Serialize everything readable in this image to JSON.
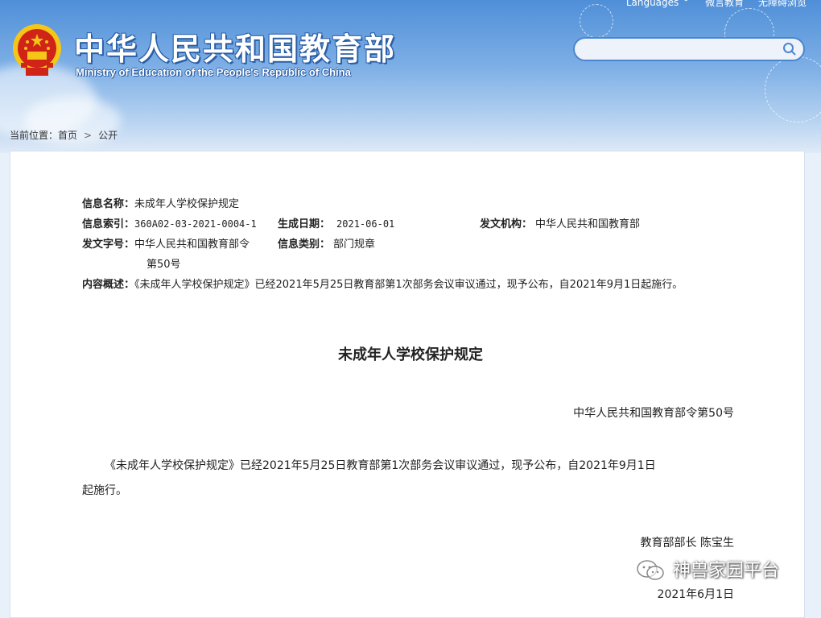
{
  "header": {
    "site_title": "中华人民共和国教育部",
    "site_subtitle": "Ministry of Education of the People's Republic of China",
    "links": [
      "Languages",
      "微言教育",
      "无障碍浏览"
    ],
    "search_placeholder": ""
  },
  "breadcrumb": {
    "prefix": "当前位置：",
    "items": [
      "首页",
      "公开"
    ],
    "separator": ">"
  },
  "meta": {
    "name_label": "信息名称：",
    "name_value": "未成年人学校保护规定",
    "index_label": "信息索引：",
    "index_value": "360A02-03-2021-0004-1",
    "date_label": "生成日期：",
    "date_value": "2021-06-01",
    "org_label": "发文机构：",
    "org_value": "中华人民共和国教育部",
    "docno_label": "发文字号：",
    "docno_value_line1": "中华人民共和国教育部令",
    "docno_value_line2": "第50号",
    "category_label": "信息类别：",
    "category_value": "部门规章",
    "summary_label": "内容概述：",
    "summary_value": "《未成年人学校保护规定》已经2021年5月25日教育部第1次部务会议审议通过，现予公布，自2021年9月1日起施行。"
  },
  "document": {
    "title": "未成年人学校保护规定",
    "order_no": "中华人民共和国教育部令第50号",
    "para_line1": "《未成年人学校保护规定》已经2021年5月25日教育部第1次部务会议审议通过，现予公布，自2021年9月1日",
    "para_line2": "起施行。",
    "signer": "教育部部长 陈宝生",
    "date": "2021年6月1日"
  },
  "watermark": {
    "text": "神兽家园平台"
  },
  "colors": {
    "accent": "#4a86cf",
    "banner_top": "#4f8fd8",
    "emblem_red": "#d02418",
    "emblem_gold": "#f5c518"
  }
}
